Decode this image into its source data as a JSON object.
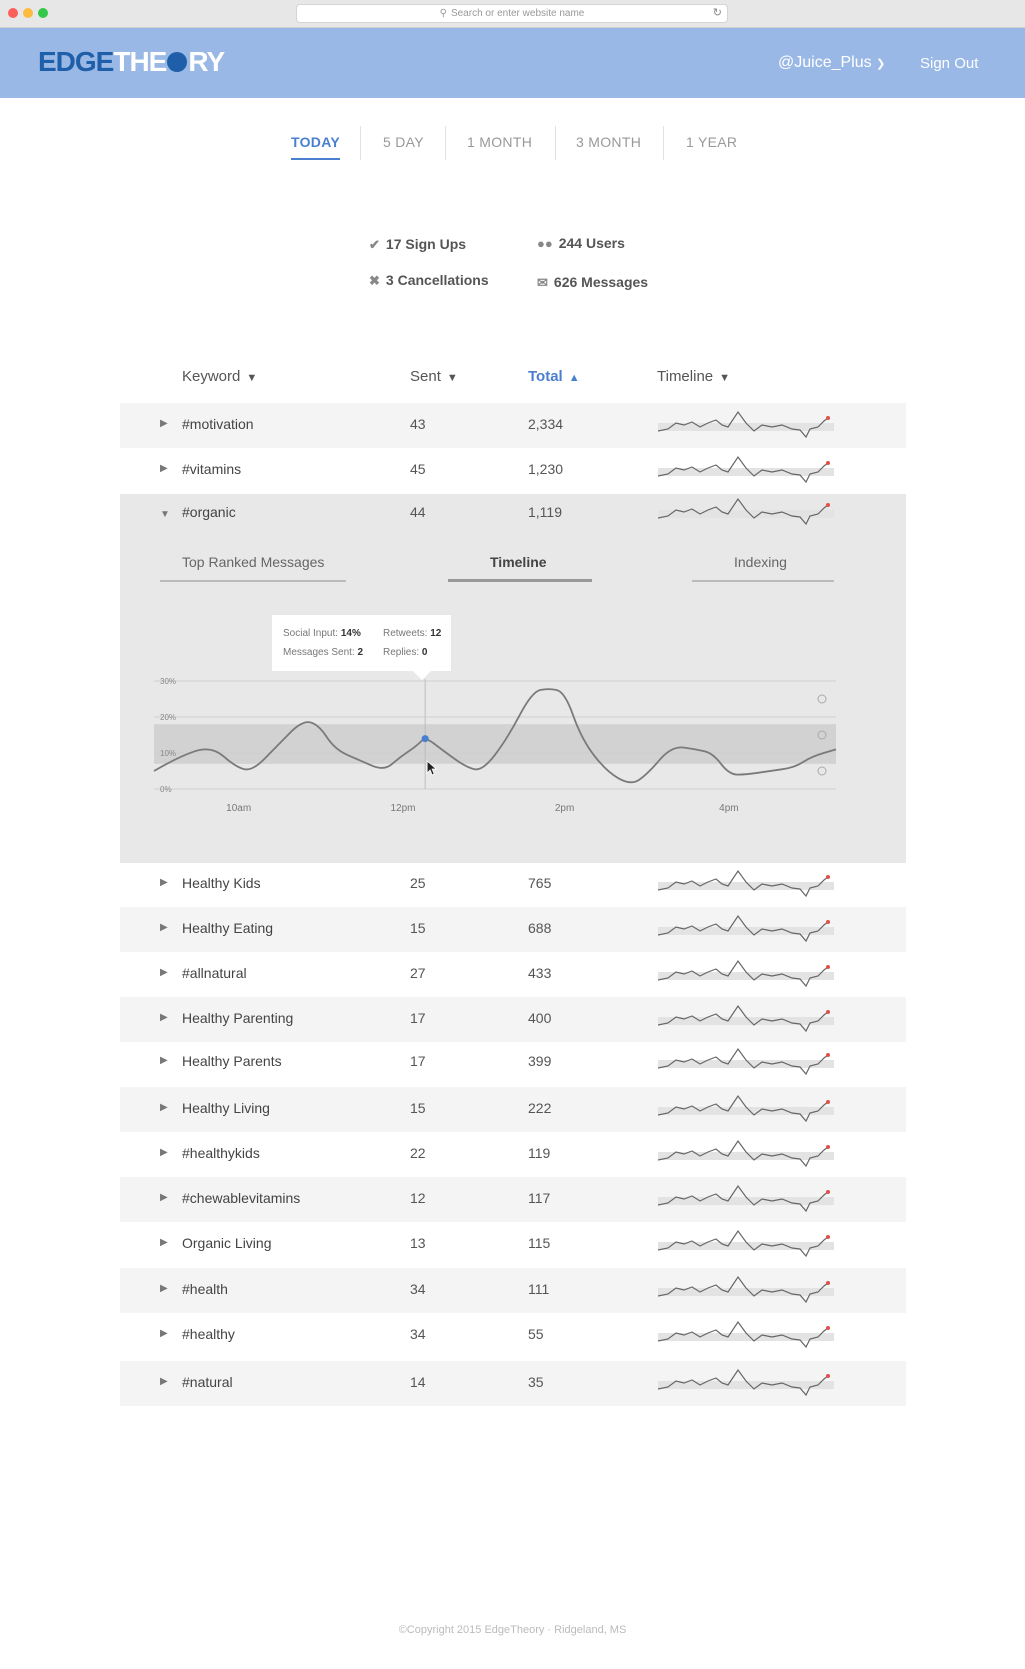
{
  "browser": {
    "url_placeholder": "Search or enter website name"
  },
  "header": {
    "logo_part1": "EDGE",
    "logo_part2": "THE",
    "logo_part3": "RY",
    "user": "@Juice_Plus",
    "sign_out": "Sign Out"
  },
  "range_tabs": [
    {
      "label": "TODAY",
      "active": true
    },
    {
      "label": "5 DAY",
      "active": false
    },
    {
      "label": "1 MONTH",
      "active": false
    },
    {
      "label": "3 MONTH",
      "active": false
    },
    {
      "label": "1 YEAR",
      "active": false
    }
  ],
  "stats": {
    "signups": "17 Sign Ups",
    "cancellations": "3 Cancellations",
    "users": "244 Users",
    "messages": "626 Messages"
  },
  "table": {
    "headers": {
      "keyword": "Keyword",
      "sent": "Sent",
      "total": "Total",
      "timeline": "Timeline"
    },
    "sort_column": "Total",
    "rows": [
      {
        "keyword": "#motivation",
        "sent": "43",
        "total": "2,334"
      },
      {
        "keyword": "#vitamins",
        "sent": "45",
        "total": "1,230"
      },
      {
        "keyword": "#organic",
        "sent": "44",
        "total": "1,119",
        "expanded": true
      },
      {
        "keyword": "Healthy Kids",
        "sent": "25",
        "total": "765"
      },
      {
        "keyword": "Healthy Eating",
        "sent": "15",
        "total": "688"
      },
      {
        "keyword": "#allnatural",
        "sent": "27",
        "total": "433"
      },
      {
        "keyword": "Healthy Parenting",
        "sent": "17",
        "total": "400"
      },
      {
        "keyword": "Healthy Parents",
        "sent": "17",
        "total": "399"
      },
      {
        "keyword": "Healthy Living",
        "sent": "15",
        "total": "222"
      },
      {
        "keyword": "#healthykids",
        "sent": "22",
        "total": "119"
      },
      {
        "keyword": "#chewablevitamins",
        "sent": "12",
        "total": "117"
      },
      {
        "keyword": "Organic Living",
        "sent": "13",
        "total": "115"
      },
      {
        "keyword": "#health",
        "sent": "34",
        "total": "111"
      },
      {
        "keyword": "#healthy",
        "sent": "34",
        "total": "55"
      },
      {
        "keyword": "#natural",
        "sent": "14",
        "total": "35"
      }
    ]
  },
  "detail": {
    "subtabs": [
      {
        "label": "Top Ranked Messages",
        "active": false
      },
      {
        "label": "Timeline",
        "active": true
      },
      {
        "label": "Indexing",
        "active": false
      }
    ],
    "tooltip": {
      "social_input_label": "Social Input:",
      "social_input_value": "14%",
      "retweets_label": "Retweets:",
      "retweets_value": "12",
      "messages_sent_label": "Messages Sent:",
      "messages_sent_value": "2",
      "replies_label": "Replies:",
      "replies_value": "0"
    }
  },
  "chart_data": {
    "type": "line",
    "title": "",
    "xlabel": "",
    "ylabel": "",
    "ylim": [
      0,
      30
    ],
    "y_ticks": [
      "0%",
      "10%",
      "20%",
      "30%"
    ],
    "x_ticks": [
      "10am",
      "12pm",
      "2pm",
      "4pm"
    ],
    "band": [
      7,
      18
    ],
    "x": [
      9.0,
      9.3,
      9.7,
      10.0,
      10.2,
      10.5,
      10.8,
      11.0,
      11.2,
      11.5,
      11.8,
      12.0,
      12.2,
      12.3,
      12.5,
      12.8,
      13.0,
      13.3,
      13.6,
      13.8,
      14.0,
      14.2,
      14.5,
      14.8,
      15.0,
      15.3,
      15.6,
      15.8,
      16.0,
      16.2,
      16.5,
      16.8,
      17.0,
      17.3
    ],
    "series": [
      {
        "values": [
          5,
          9,
          12,
          6,
          5,
          12,
          19,
          18,
          11,
          8,
          5,
          9,
          12,
          14.5,
          11,
          6,
          5,
          14,
          27,
          28,
          27,
          14,
          5,
          1,
          4,
          12,
          11,
          10,
          4,
          4,
          5,
          6,
          9,
          11
        ]
      }
    ],
    "highlight": {
      "x": 12.3,
      "y": 14
    }
  },
  "footer": {
    "text": "©Copyright 2015 EdgeTheory · Ridgeland, MS"
  },
  "colors": {
    "header": "#99b8e6",
    "accent": "#4a7fd0",
    "spark_end": "#e0514a"
  }
}
